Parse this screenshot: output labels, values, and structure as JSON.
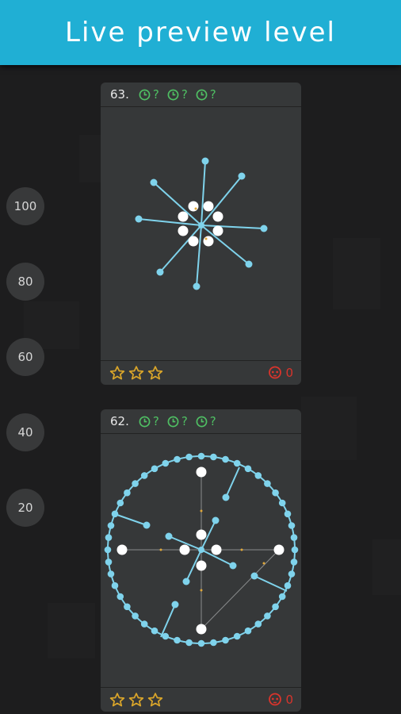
{
  "header": {
    "title": "Live preview level"
  },
  "scale": [
    "100",
    "80",
    "60",
    "40",
    "20"
  ],
  "colors": {
    "accent": "#20afd4",
    "timer": "#4fbf63",
    "star": "#d9a52a",
    "death": "#d9342c",
    "node": "#7fd3ec"
  },
  "levels": [
    {
      "number": "63.",
      "timers": [
        "?",
        "?",
        "?"
      ],
      "deaths": "0"
    },
    {
      "number": "62.",
      "timers": [
        "?",
        "?",
        "?"
      ],
      "deaths": "0"
    }
  ]
}
